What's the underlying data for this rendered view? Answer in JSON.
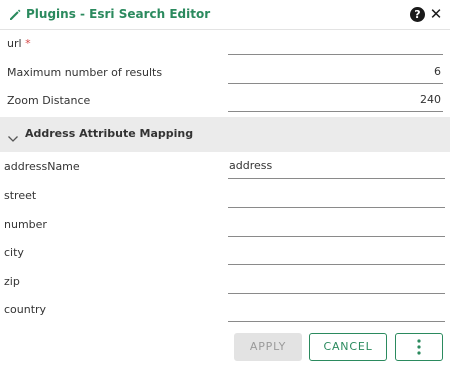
{
  "header": {
    "title": "Plugins - Esri Search Editor",
    "icons": {
      "edit": "pencil-icon",
      "help": "help-icon",
      "close": "close-icon"
    },
    "help_glyph": "?",
    "close_glyph": "✕"
  },
  "fields": {
    "url": {
      "label": "url",
      "required_mark": "*",
      "value": ""
    },
    "max_results": {
      "label": "Maximum number of results",
      "value": "6"
    },
    "zoom_distance": {
      "label": "Zoom Distance",
      "value": "240"
    }
  },
  "section": {
    "title": "Address Attribute Mapping",
    "icon": "chevron-down-icon"
  },
  "mapping": [
    {
      "label": "addressName",
      "value": "address"
    },
    {
      "label": "street",
      "value": ""
    },
    {
      "label": "number",
      "value": ""
    },
    {
      "label": "city",
      "value": ""
    },
    {
      "label": "zip",
      "value": ""
    },
    {
      "label": "country",
      "value": ""
    }
  ],
  "actions": {
    "apply": "APPLY",
    "cancel": "CANCEL",
    "more_icon": "more-vertical-icon"
  },
  "colors": {
    "accent": "#2b8a5e",
    "required": "#d64545",
    "section_bg": "#ebebeb",
    "disabled_bg": "#e3e3e3"
  }
}
